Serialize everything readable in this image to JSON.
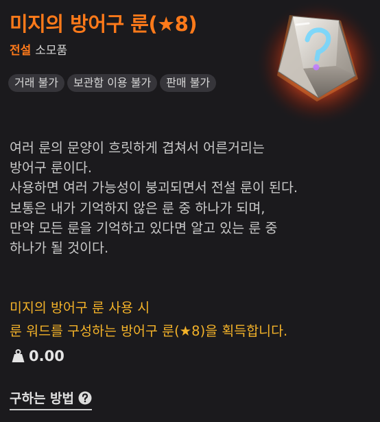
{
  "item": {
    "name": "미지의 방어구 룬(★8)",
    "grade": "전설",
    "category": "소모품",
    "tags": [
      "거래 불가",
      "보관함 이용 불가",
      "판매 불가"
    ],
    "icon": "mystery-rune-gem-icon",
    "description": [
      "여러 룬의 문양이 흐릿하게 겹쳐서 어른거리는",
      "방어구 룬이다.",
      "사용하면 여러 가능성이 붕괴되면서 전설 룬이 된다.",
      "보통은 내가 기억하지 않은 룬 중 하나가 되며,",
      "만약 모든 룬을 기억하고 있다면 알고 있는 룬 중",
      "하나가 될 것이다."
    ],
    "effect": {
      "line1": "미지의 방어구 룬 사용 시",
      "line2": "룬 워드를 구성하는 방어구 룬(★8)을 획득합니다."
    },
    "price": "0.00",
    "howto_label": "구하는 방법"
  },
  "colors": {
    "grade": "#ff7a1a",
    "effect": "#f3b229",
    "tag_bg": "#36353a",
    "background": "#1b1a1d"
  }
}
